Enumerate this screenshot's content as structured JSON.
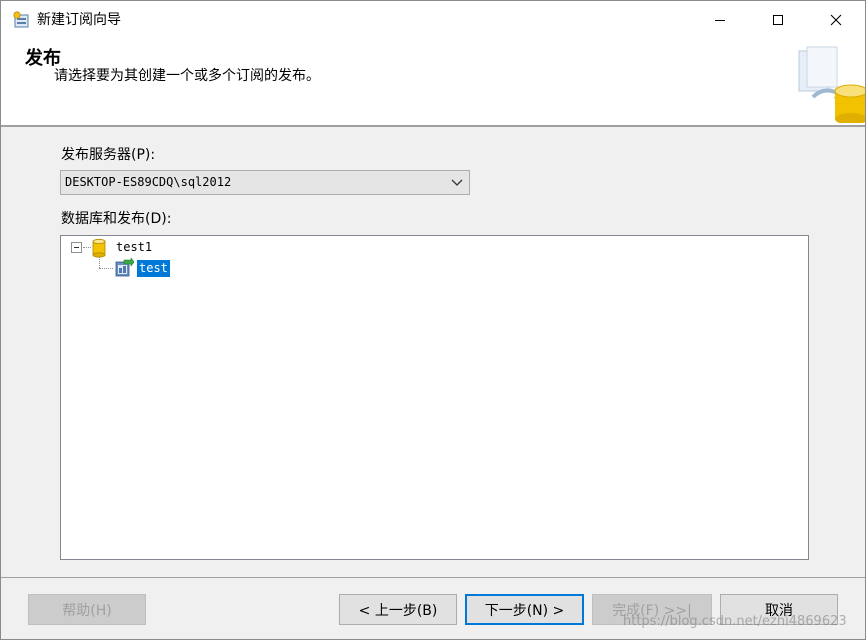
{
  "window": {
    "title": "新建订阅向导"
  },
  "header": {
    "title": "发布",
    "subtitle": "请选择要为其创建一个或多个订阅的发布。"
  },
  "publisher": {
    "label": "发布服务器(P):",
    "selected": "DESKTOP-ES89CDQ\\sql2012"
  },
  "databases": {
    "label": "数据库和发布(D):",
    "tree": [
      {
        "name": "test1",
        "expanded": true,
        "icon": "database-icon",
        "children": [
          {
            "name": "test",
            "icon": "publication-icon",
            "selected": true
          }
        ]
      }
    ]
  },
  "footer": {
    "help_label": "帮助(H)",
    "back_label": "< 上一步(B)",
    "next_label": "下一步(N) >",
    "finish_label": "完成(F) >>|",
    "cancel_label": "取消",
    "watermark": "https://blog.csdn.net/ezhi4869623"
  },
  "colors": {
    "selection": "#0078d7",
    "window_bg": "#f0f0f0"
  }
}
